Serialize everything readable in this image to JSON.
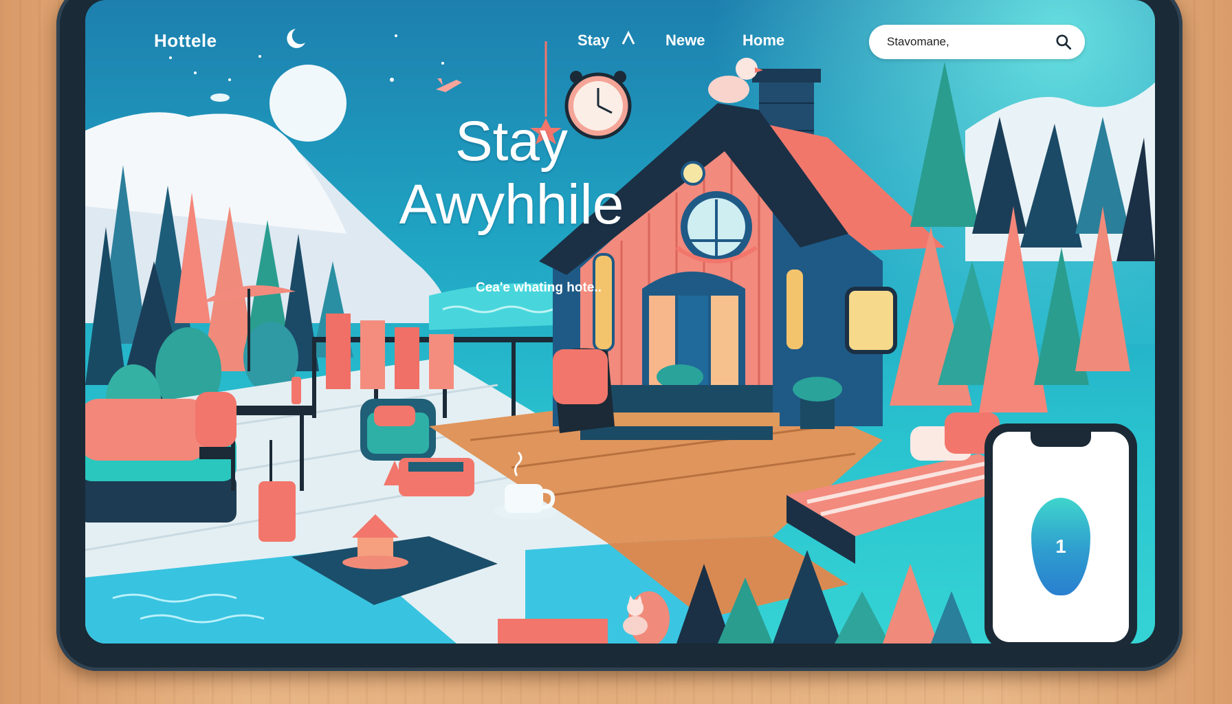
{
  "brand": {
    "name": "Hottele"
  },
  "nav": {
    "items": [
      {
        "label": "Stay"
      },
      {
        "label": "Newe"
      },
      {
        "label": "Home"
      }
    ]
  },
  "search": {
    "value": "Stavomane,",
    "icon": "search-icon"
  },
  "hero": {
    "title_line1": "Stay",
    "title_line2": "Awyhhile",
    "subtitle": "Cea'e whating hote.."
  },
  "phone": {
    "badge": "1"
  },
  "colors": {
    "sky_top": "#1d7fae",
    "sky_bottom": "#35d3d4",
    "coral": "#f2776b",
    "navy": "#1b2a36",
    "teal": "#27a3a3",
    "wood": "#e09a5c"
  }
}
